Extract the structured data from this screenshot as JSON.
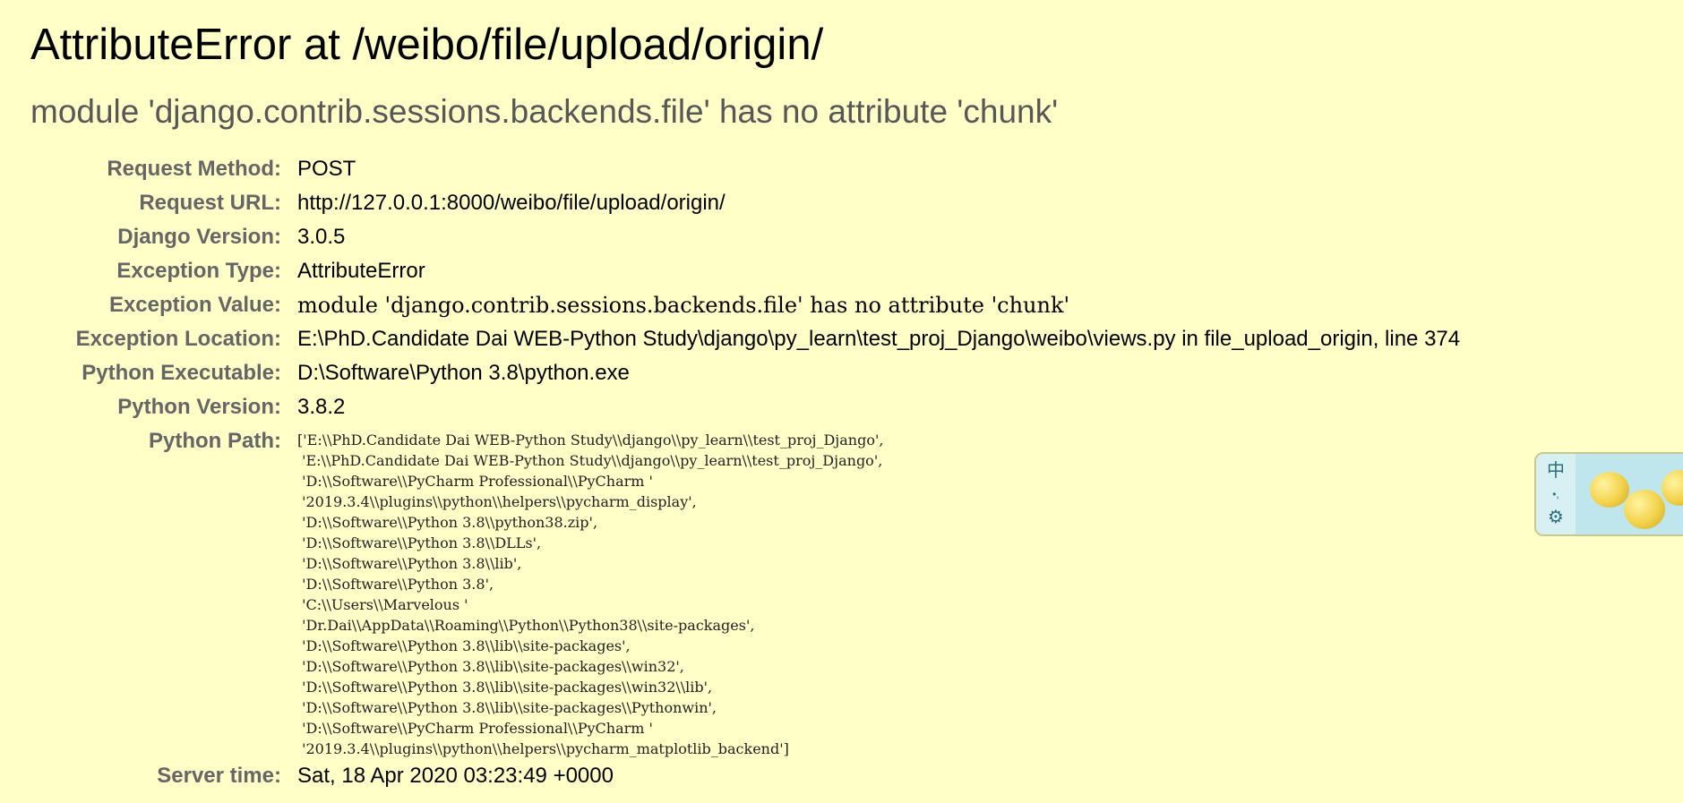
{
  "error": {
    "title": "AttributeError at /weibo/file/upload/origin/",
    "message": "module 'django.contrib.sessions.backends.file' has no attribute 'chunk'"
  },
  "meta": {
    "request_method_label": "Request Method:",
    "request_method": "POST",
    "request_url_label": "Request URL:",
    "request_url": "http://127.0.0.1:8000/weibo/file/upload/origin/",
    "django_version_label": "Django Version:",
    "django_version": "3.0.5",
    "exception_type_label": "Exception Type:",
    "exception_type": "AttributeError",
    "exception_value_label": "Exception Value:",
    "exception_value": "module 'django.contrib.sessions.backends.file' has no attribute 'chunk'",
    "exception_location_label": "Exception Location:",
    "exception_location": "E:\\PhD.Candidate Dai WEB-Python Study\\django\\py_learn\\test_proj_Django\\weibo\\views.py in file_upload_origin, line 374",
    "python_executable_label": "Python Executable:",
    "python_executable": "D:\\Software\\Python 3.8\\python.exe",
    "python_version_label": "Python Version:",
    "python_version": "3.8.2",
    "python_path_label": "Python Path:",
    "python_path": "['E:\\\\PhD.Candidate Dai WEB-Python Study\\\\django\\\\py_learn\\\\test_proj_Django',\n 'E:\\\\PhD.Candidate Dai WEB-Python Study\\\\django\\\\py_learn\\\\test_proj_Django',\n 'D:\\\\Software\\\\PyCharm Professional\\\\PyCharm '\n '2019.3.4\\\\plugins\\\\python\\\\helpers\\\\pycharm_display',\n 'D:\\\\Software\\\\Python 3.8\\\\python38.zip',\n 'D:\\\\Software\\\\Python 3.8\\\\DLLs',\n 'D:\\\\Software\\\\Python 3.8\\\\lib',\n 'D:\\\\Software\\\\Python 3.8',\n 'C:\\\\Users\\\\Marvelous '\n 'Dr.Dai\\\\AppData\\\\Roaming\\\\Python\\\\Python38\\\\site-packages',\n 'D:\\\\Software\\\\Python 3.8\\\\lib\\\\site-packages',\n 'D:\\\\Software\\\\Python 3.8\\\\lib\\\\site-packages\\\\win32',\n 'D:\\\\Software\\\\Python 3.8\\\\lib\\\\site-packages\\\\win32\\\\lib',\n 'D:\\\\Software\\\\Python 3.8\\\\lib\\\\site-packages\\\\Pythonwin',\n 'D:\\\\Software\\\\PyCharm Professional\\\\PyCharm '\n '2019.3.4\\\\plugins\\\\python\\\\helpers\\\\pycharm_matplotlib_backend']",
    "server_time_label": "Server time:",
    "server_time": "Sat, 18 Apr 2020 03:23:49 +0000"
  },
  "ime_widget": {
    "chinese_mode_glyph": "中",
    "punctuation_glyph": "•,",
    "settings_glyph": "⚙",
    "icons": [
      "chinese-mode-icon",
      "punctuation-icon",
      "settings-icon"
    ]
  },
  "colors": {
    "background": "#ffffc8",
    "subtitle": "#575757",
    "label": "#666666"
  }
}
